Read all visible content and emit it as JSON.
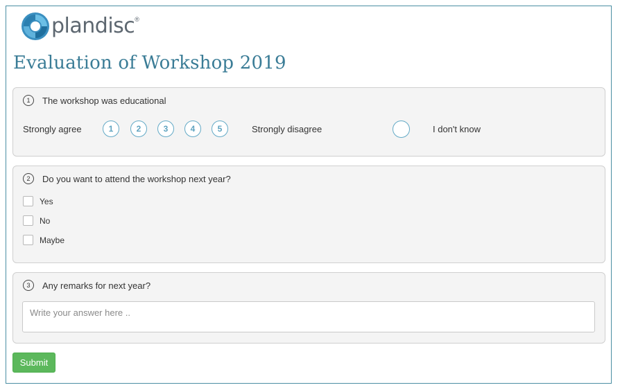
{
  "brand": {
    "name": "plandisc",
    "reg_mark": "®",
    "logo_icon": "plandisc-swirl-icon",
    "color": "#3a8fc0"
  },
  "page": {
    "title": "Evaluation of Workshop 2019"
  },
  "questions": [
    {
      "number": "1",
      "text": "The workshop was educational",
      "type": "scale",
      "left_label": "Strongly agree",
      "right_label": "Strongly disagree",
      "options": [
        "1",
        "2",
        "3",
        "4",
        "5"
      ],
      "dont_know_label": "I don't know"
    },
    {
      "number": "2",
      "text": "Do you want to attend the workshop next year?",
      "type": "checkbox",
      "options": [
        "Yes",
        "No",
        "Maybe"
      ]
    },
    {
      "number": "3",
      "text": "Any remarks for next year?",
      "type": "text",
      "placeholder": "Write your answer here .."
    }
  ],
  "actions": {
    "submit_label": "Submit"
  },
  "colors": {
    "accent": "#3a7c96",
    "scale_border": "#62a9c6",
    "submit": "#5cb85c"
  }
}
